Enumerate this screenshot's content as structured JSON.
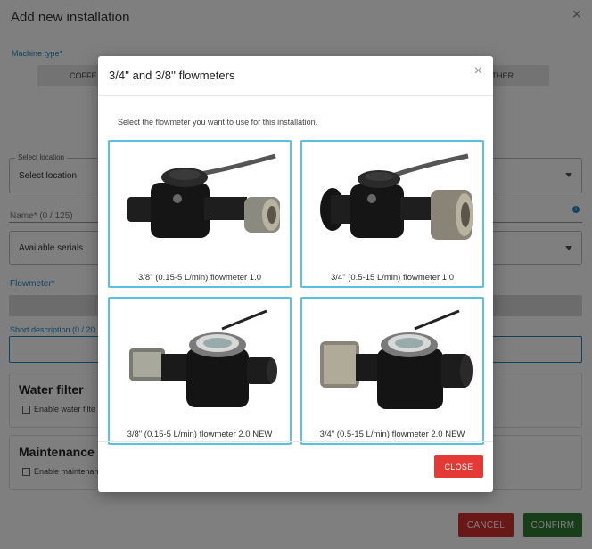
{
  "background": {
    "title": "Add new installation",
    "close_icon": "×",
    "machine_type_label": "Machine type*",
    "machine_type_left": "COFFE",
    "machine_type_right": "THER",
    "select_location_legend": "Select location",
    "select_location_value": "Select location",
    "name_label": "Name* (0 / 125)",
    "info_icon": "i",
    "available_serials": "Available serials",
    "flowmeter_label": "Flowmeter*",
    "short_description_label": "Short description (0 / 20",
    "water_filter_title": "Water filter",
    "water_filter_checkbox": "Enable water filte",
    "maintenance_title": "Maintenance",
    "maintenance_checkbox": "Enable maintenan",
    "cancel_label": "CANCEL",
    "confirm_label": "CONFIRM"
  },
  "modal": {
    "title": "3/4'' and 3/8'' flowmeters",
    "close_icon": "×",
    "instruction": "Select the flowmeter you want to use for this installation.",
    "options": [
      {
        "label": "3/8\" (0.15-5 L/min) flowmeter 1.0"
      },
      {
        "label": "3/4\" (0.5-15 L/min) flowmeter 1.0"
      },
      {
        "label": "3/8\" (0.15-5 L/min) flowmeter 2.0 NEW"
      },
      {
        "label": "3/4\" (0.5-15 L/min) flowmeter 2.0 NEW"
      }
    ],
    "close_button": "CLOSE"
  },
  "colors": {
    "accent_blue": "#1e88c7",
    "tile_border": "#5bc0de",
    "danger": "#e53935",
    "success": "#2e7d32"
  }
}
